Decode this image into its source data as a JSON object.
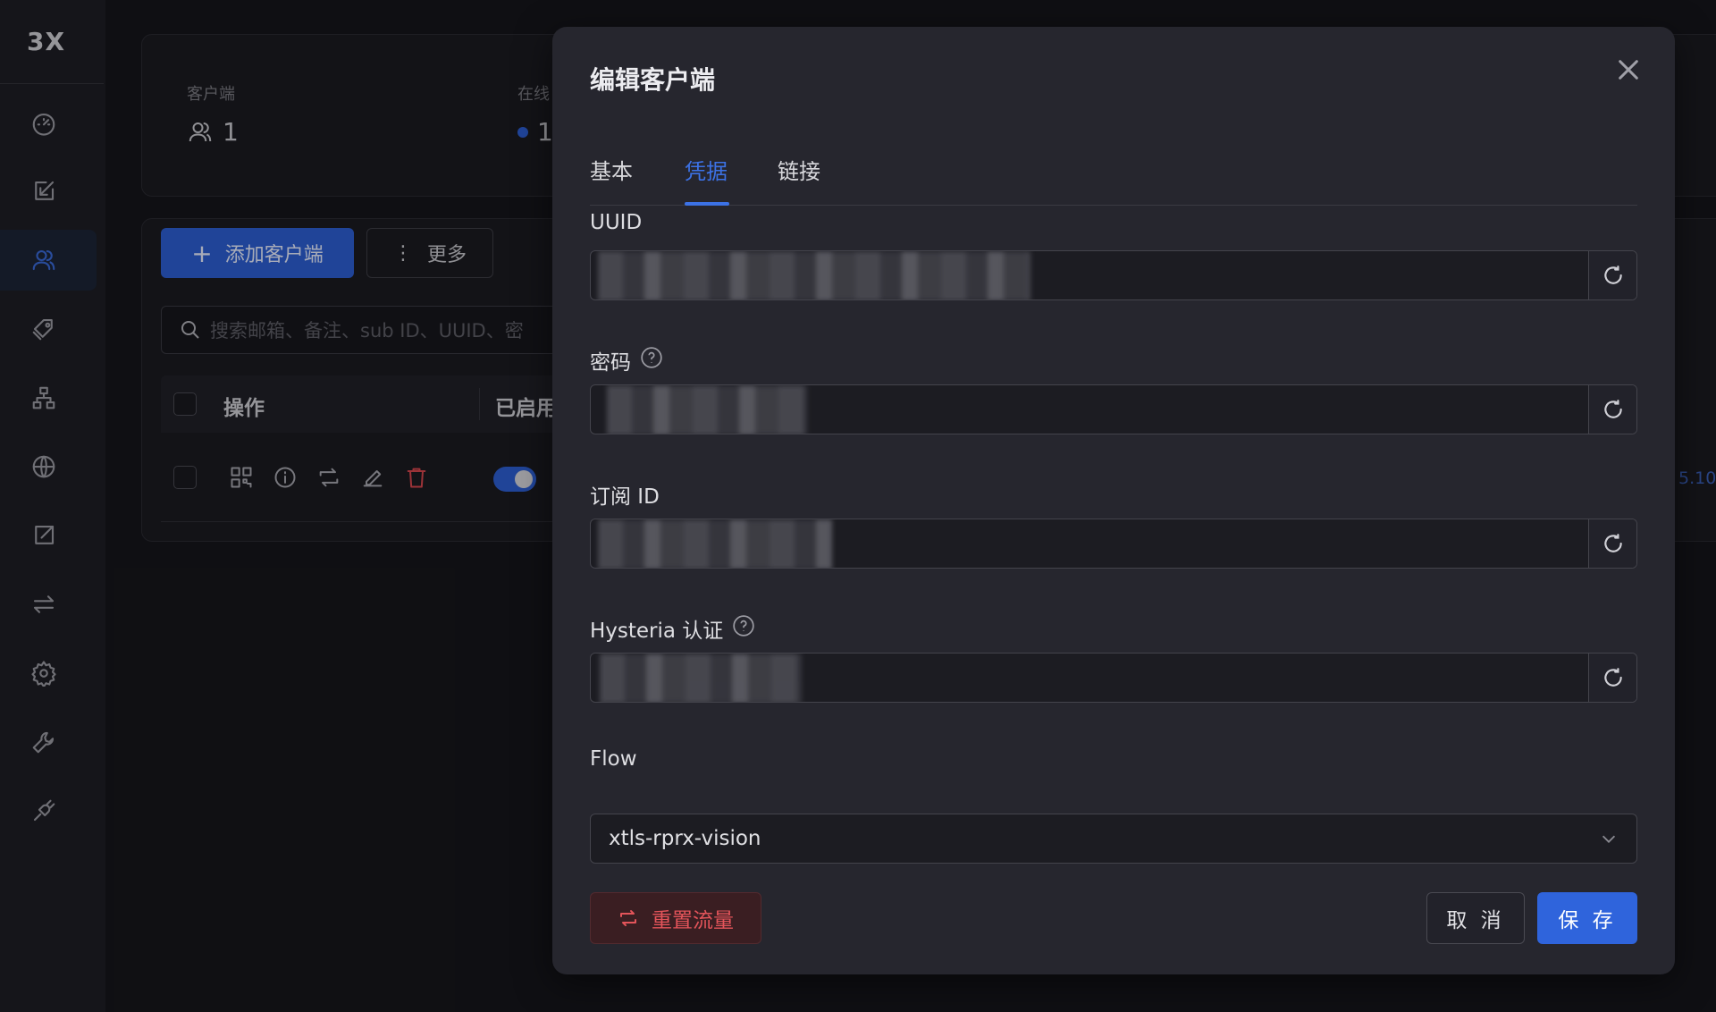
{
  "app": {
    "logo": "3X"
  },
  "sidebar": {
    "items": [
      {
        "icon": "dashboard-icon"
      },
      {
        "icon": "inbounds-icon"
      },
      {
        "icon": "clients-icon",
        "active": true
      },
      {
        "icon": "tag-icon"
      },
      {
        "icon": "sitemap-icon"
      },
      {
        "icon": "globe-icon"
      },
      {
        "icon": "export-icon"
      },
      {
        "icon": "transfer-icon"
      },
      {
        "icon": "gear-icon"
      },
      {
        "icon": "wrench-icon"
      },
      {
        "icon": "plug-icon"
      }
    ]
  },
  "stats": {
    "clients_label": "客户端",
    "clients_value": "1",
    "online_label": "在线",
    "online_value": "1"
  },
  "toolbar": {
    "add_client_label": "添加客户端",
    "more_label": "更多",
    "search_placeholder": "搜索邮箱、备注、sub ID、UUID、密"
  },
  "table": {
    "col_actions": "操作",
    "col_enabled": "已启用",
    "edge_value": "5.10"
  },
  "modal": {
    "title": "编辑客户端",
    "tabs": [
      {
        "label": "基本"
      },
      {
        "label": "凭据",
        "active": true
      },
      {
        "label": "链接"
      }
    ],
    "fields": {
      "uuid_label": "UUID",
      "uuid_value": "",
      "password_label": "密码",
      "password_value": "",
      "sub_id_label": "订阅 ID",
      "sub_id_value": "",
      "hysteria_label": "Hysteria 认证",
      "hysteria_value": "",
      "flow_label": "Flow",
      "flow_value": "xtls-rprx-vision"
    },
    "buttons": {
      "reset_traffic": "重置流量",
      "cancel": "取 消",
      "save": "保 存"
    }
  },
  "colors": {
    "accent": "#3c72e6",
    "primary_button": "#2f64dc",
    "danger": "#e3545a"
  }
}
